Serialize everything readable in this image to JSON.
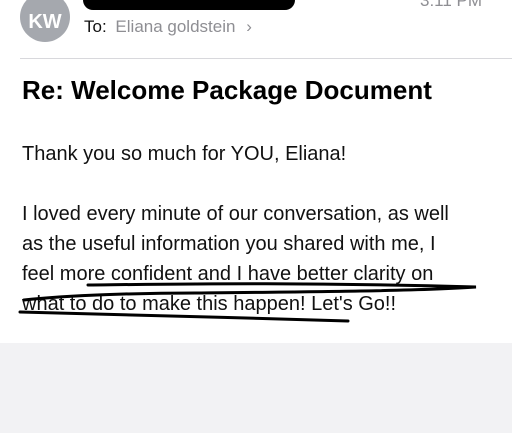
{
  "header": {
    "avatar_initials": "KW",
    "time": "3:11 PM",
    "to_label": "To:",
    "recipient": "Eliana goldstein",
    "chevron": "›"
  },
  "message": {
    "subject": "Re: Welcome Package Document",
    "body": [
      "Thank you so much for YOU, Eliana!",
      "I loved every minute of our conversation, as well",
      "as the useful information you shared with me, I",
      "feel more confident and I have better clarity on",
      "what to do to make this happen! Let's Go!!"
    ]
  },
  "colors": {
    "avatar_bg": "#a5a8ae",
    "secondary_text": "#8e8e93",
    "ink": "#000000"
  }
}
